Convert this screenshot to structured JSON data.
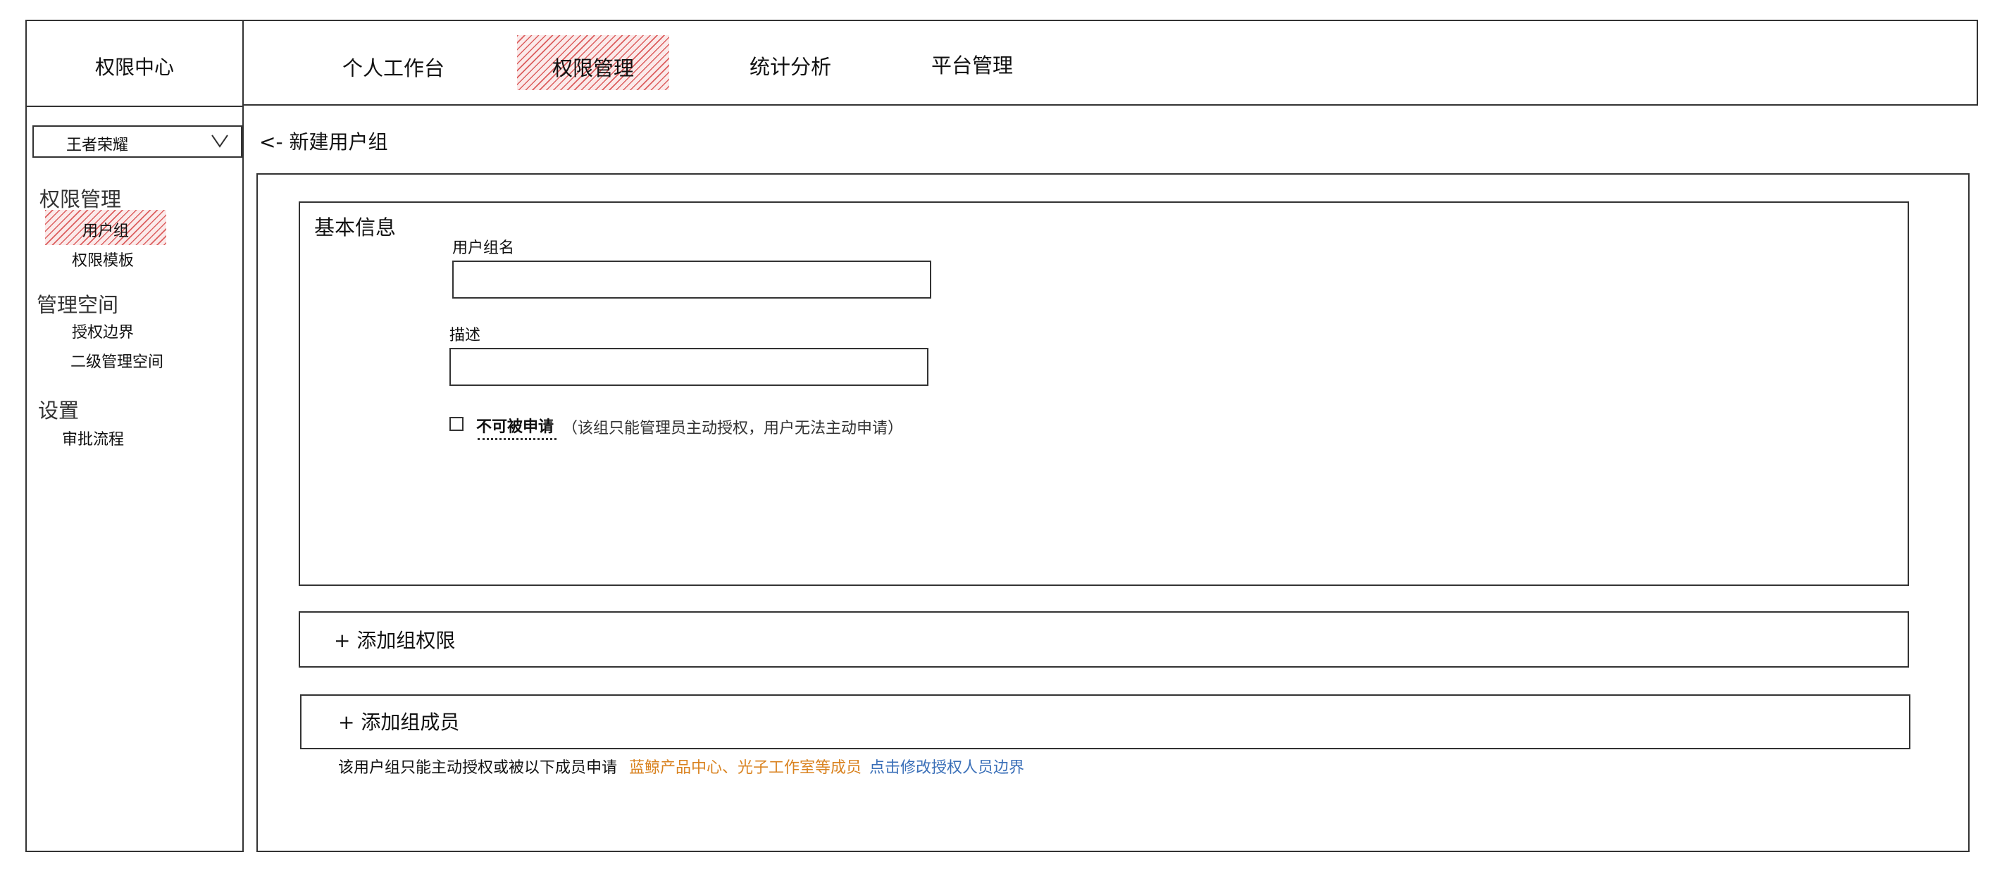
{
  "app": {
    "title": "权限中心"
  },
  "topnav": {
    "tabs": [
      {
        "label": "个人工作台",
        "active": false
      },
      {
        "label": "权限管理",
        "active": true
      },
      {
        "label": "统计分析",
        "active": false
      },
      {
        "label": "平台管理",
        "active": false
      }
    ]
  },
  "sidebar": {
    "project_select": {
      "value": "王者荣耀",
      "icon": "chevron-down-icon"
    },
    "sections": [
      {
        "title": "权限管理",
        "items": [
          {
            "label": "用户组",
            "active": true
          },
          {
            "label": "权限模板",
            "active": false
          }
        ]
      },
      {
        "title": "管理空间",
        "items": [
          {
            "label": "授权边界",
            "active": false
          },
          {
            "label": "二级管理空间",
            "active": false
          }
        ]
      },
      {
        "title": "设置",
        "items": [
          {
            "label": "审批流程",
            "active": false
          }
        ]
      }
    ]
  },
  "page": {
    "back_label": "<- 新建用户组",
    "basic_info": {
      "title": "基本信息",
      "group_name_label": "用户组名",
      "group_name_value": "",
      "description_label": "描述",
      "description_value": "",
      "not_applicable_label": "不可被申请",
      "not_applicable_checked": false,
      "not_applicable_hint": "（该组只能管理员主动授权，用户无法主动申请）"
    },
    "add_permissions_label": "+ 添加组权限",
    "add_members_label": "+ 添加组成员",
    "member_note": {
      "prefix": "该用户组只能主动授权或被以下成员申请",
      "members": "蓝鲸产品中心、光子工作室等成员",
      "edit_link": "点击修改授权人员边界"
    }
  },
  "colors": {
    "hatch": "#d64646",
    "member_highlight": "#d9821f",
    "link": "#3a6fb8"
  }
}
